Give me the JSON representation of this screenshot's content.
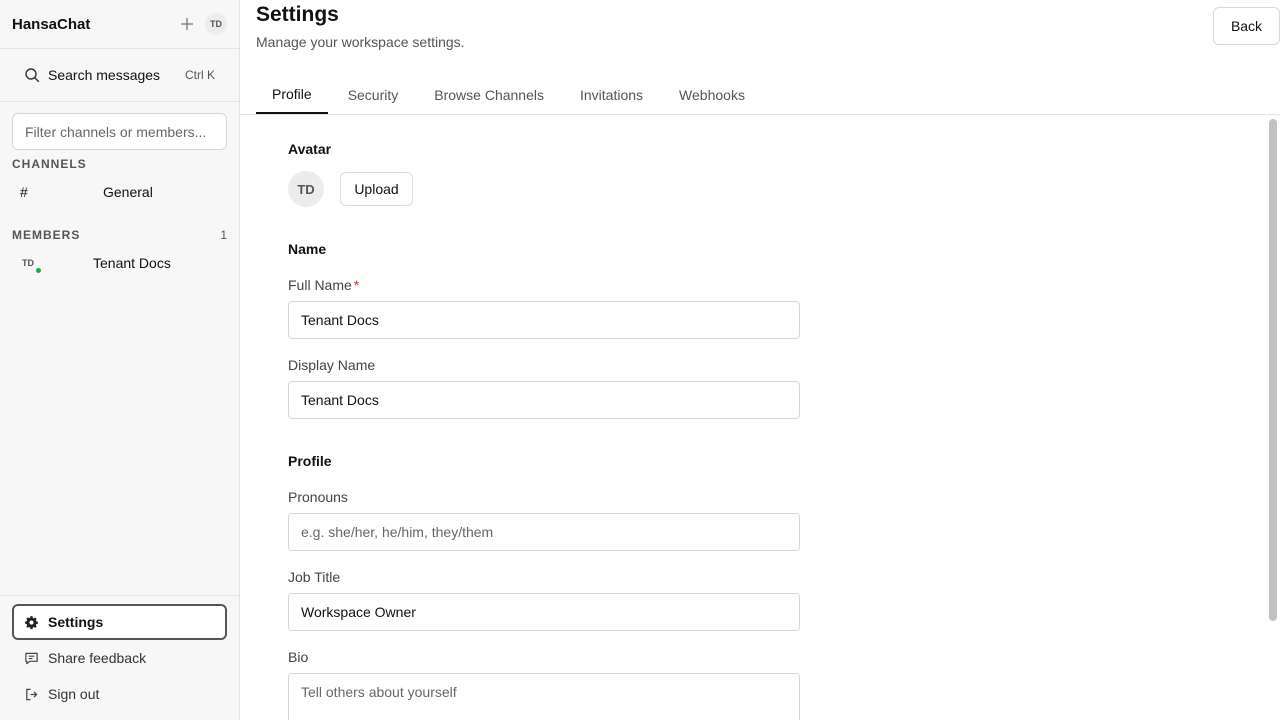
{
  "app": {
    "name": "HansaChat",
    "user_initials": "TD"
  },
  "sidebar": {
    "search": {
      "label": "Search messages",
      "shortcut": "Ctrl K"
    },
    "filter_placeholder": "Filter channels or members...",
    "channels": {
      "heading": "CHANNELS",
      "items": [
        {
          "name": "General"
        }
      ]
    },
    "members": {
      "heading": "MEMBERS",
      "count": "1",
      "items": [
        {
          "initials": "TD",
          "name": "Tenant Docs",
          "status_color": "#22a447"
        }
      ]
    },
    "footer": {
      "settings": "Settings",
      "feedback": "Share feedback",
      "signout": "Sign out"
    }
  },
  "header": {
    "title": "Settings",
    "subtitle": "Manage your workspace settings.",
    "back": "Back"
  },
  "tabs": [
    {
      "label": "Profile",
      "active": true
    },
    {
      "label": "Security"
    },
    {
      "label": "Browse Channels"
    },
    {
      "label": "Invitations"
    },
    {
      "label": "Webhooks"
    }
  ],
  "form": {
    "avatar": {
      "title": "Avatar",
      "initials": "TD",
      "upload": "Upload"
    },
    "name_section": "Name",
    "full_name": {
      "label": "Full Name",
      "required_mark": "*",
      "value": "Tenant Docs"
    },
    "display_name": {
      "label": "Display Name",
      "value": "Tenant Docs"
    },
    "profile_section": "Profile",
    "pronouns": {
      "label": "Pronouns",
      "placeholder": "e.g. she/her, he/him, they/them"
    },
    "job_title": {
      "label": "Job Title",
      "value": "Workspace Owner"
    },
    "bio": {
      "label": "Bio",
      "placeholder": "Tell others about yourself"
    }
  }
}
